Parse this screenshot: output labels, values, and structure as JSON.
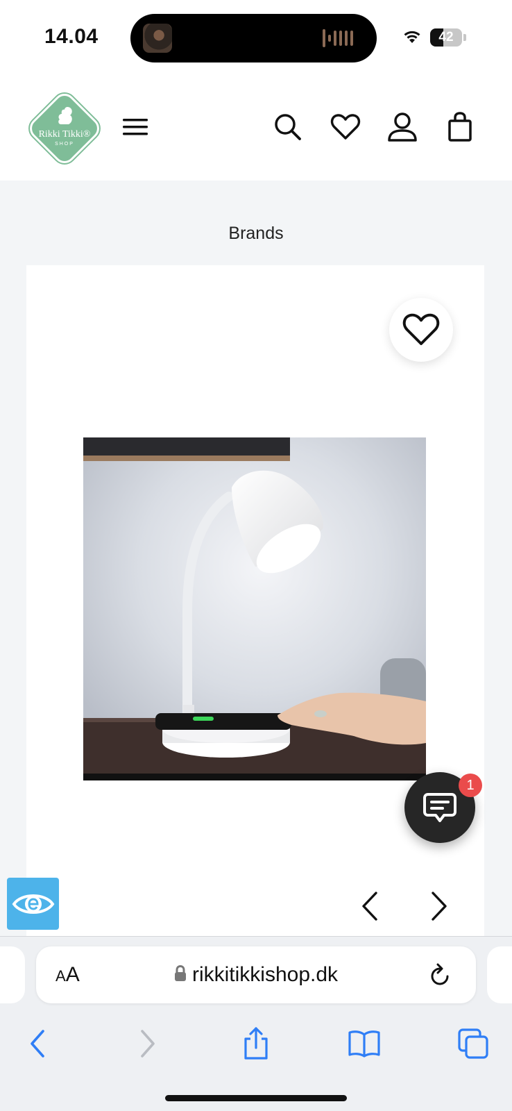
{
  "status_bar": {
    "time": "14.04",
    "battery_level": "42",
    "battery_fraction": 0.42
  },
  "header": {
    "logo_text": "Rikki Tikki®",
    "logo_sub": "SHOP",
    "icons": [
      "menu-icon",
      "search-icon",
      "heart-icon",
      "account-icon",
      "bag-icon"
    ]
  },
  "breadcrumb": "Brands",
  "product": {
    "image": "desk lamp with wireless charging base",
    "wishlist_icon": "heart-icon",
    "prev_icon": "chevron-left-icon",
    "next_icon": "chevron-right-icon"
  },
  "chat": {
    "badge_count": "1",
    "icon": "chat-bubble-icon"
  },
  "accessibility": {
    "icon": "eye-icon",
    "color": "#4db3ea"
  },
  "safari": {
    "text_size_label_small": "A",
    "text_size_label_large": "A",
    "url": "rikkitikkishop.dk",
    "accent": "#2f7ef6",
    "toolbar_icons": [
      "back-icon",
      "forward-icon",
      "share-icon",
      "bookmarks-icon",
      "tabs-icon"
    ]
  },
  "colors": {
    "brand_green": "#7fbd98",
    "chat_badge": "#ea4b4b",
    "page_bg": "#f3f5f7"
  }
}
